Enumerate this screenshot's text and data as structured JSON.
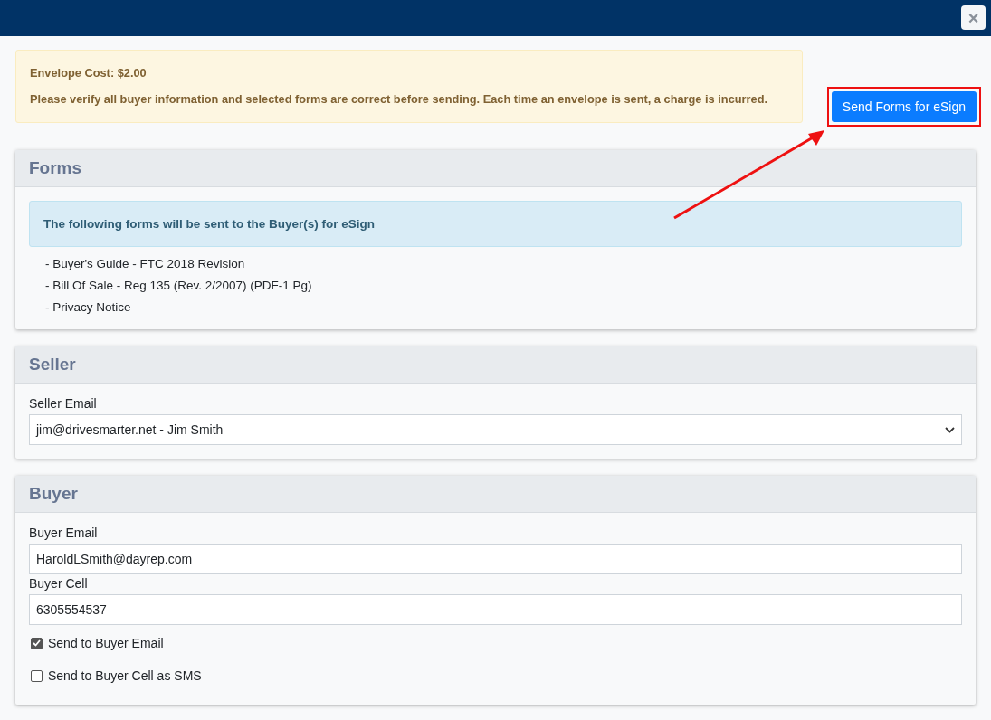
{
  "close_button": {
    "label": "×"
  },
  "notice": {
    "cost": "Envelope Cost: $2.00",
    "message": "Please verify all buyer information and selected forms are correct before sending. Each time an envelope is sent, a charge is incurred."
  },
  "send_button": {
    "label": "Send Forms for eSign",
    "highlighted": true
  },
  "forms": {
    "title": "Forms",
    "info": "The following forms will be sent to the Buyer(s) for eSign",
    "items": [
      "- Buyer's Guide - FTC 2018 Revision",
      "- Bill Of Sale - Reg 135 (Rev. 2/2007) (PDF-1 Pg)",
      "- Privacy Notice"
    ]
  },
  "seller": {
    "title": "Seller",
    "email_label": "Seller Email",
    "email_value": "jim@drivesmarter.net - Jim Smith"
  },
  "buyer": {
    "title": "Buyer",
    "fields": [
      {
        "label": "Buyer Email",
        "value": "HaroldLSmith@dayrep.com"
      },
      {
        "label": "Buyer Cell",
        "value": "6305554537"
      }
    ],
    "options": [
      {
        "label": "Send to Buyer Email",
        "checked": true
      },
      {
        "label": "Send to Buyer Cell as SMS",
        "checked": false
      }
    ]
  }
}
